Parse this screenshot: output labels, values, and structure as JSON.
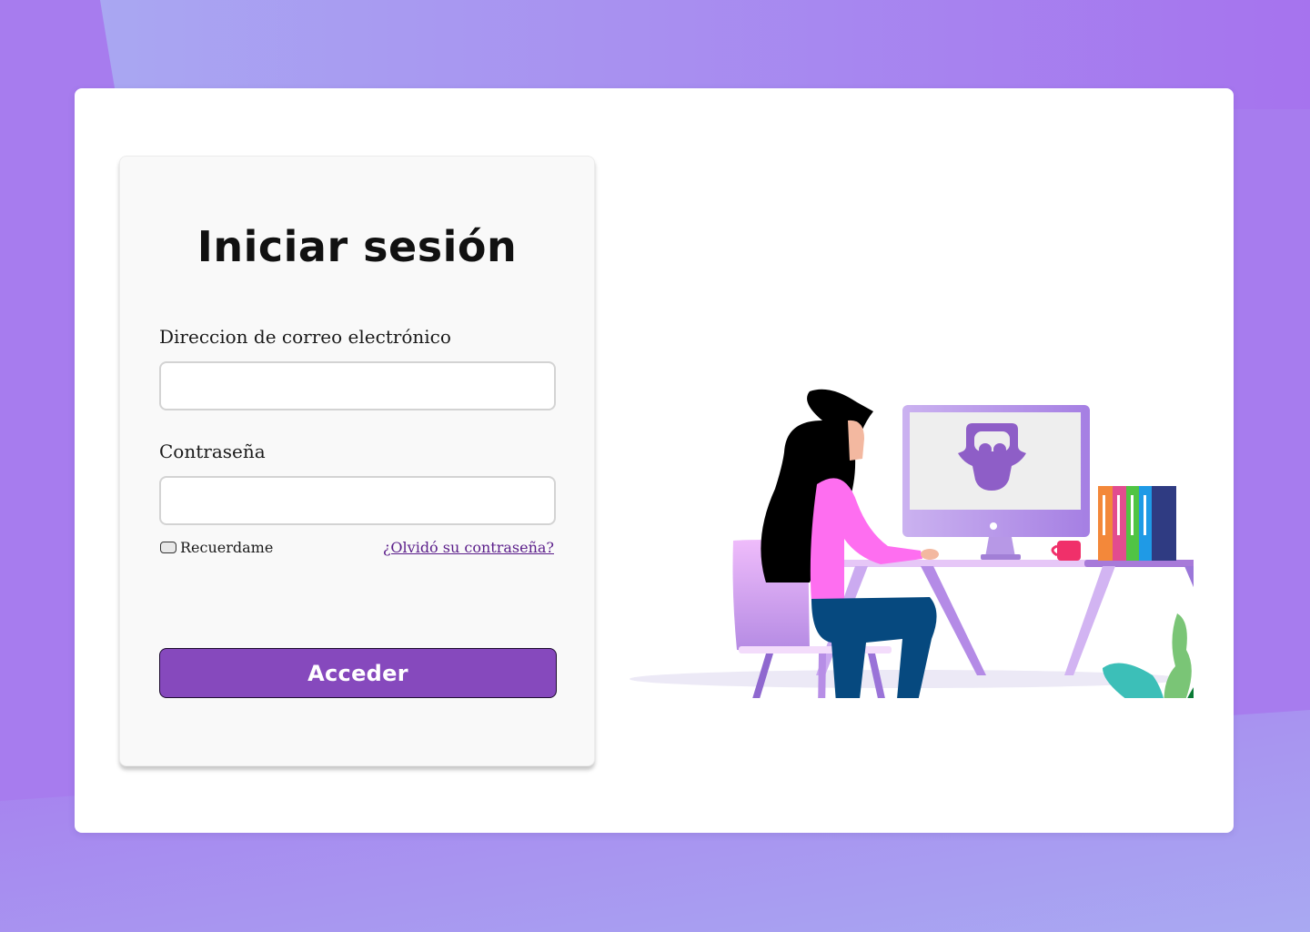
{
  "login": {
    "title": "Iniciar sesión",
    "email_label": "Direccion de correo electrónico",
    "email_value": "",
    "password_label": "Contraseña",
    "password_value": "",
    "remember_label": "Recuerdame",
    "remember_checked": false,
    "forgot_label": "¿Olvidó su contraseña?",
    "submit_label": "Acceder"
  },
  "colors": {
    "background": "#a77cee",
    "accent": "#8649bd",
    "link": "#5b1e8a"
  },
  "illustration": {
    "subject": "woman-at-desk-illustration",
    "monitor_icon": "owl-logo-icon"
  }
}
